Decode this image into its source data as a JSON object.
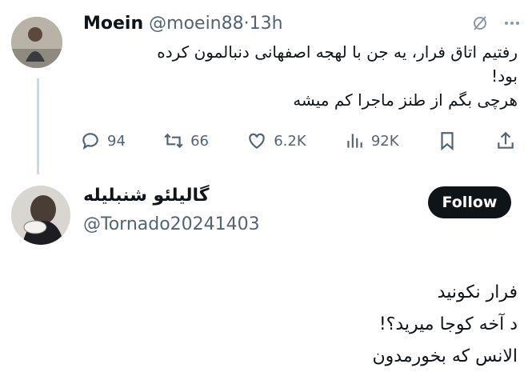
{
  "tweet": {
    "author_name": "Moein",
    "author_handle": "@moein88",
    "separator": "·",
    "time": "13h",
    "lines": [
      "رفتیم اتاق فرار، یه جن با لهجه اصفهانی دنبالمون کرده",
      "بود!",
      "هرچی بگم از طنز ماجرا کم میشه"
    ],
    "actions": {
      "replies": "94",
      "retweets": "66",
      "likes": "6.2K",
      "views": "92K"
    }
  },
  "reply": {
    "author_name": "گالیلئو شنبلیله",
    "author_handle": "@Tornado20241403",
    "follow_label": "Follow",
    "lines": [
      "فرار نکونید",
      "د آخه کوجا میرید؟!",
      "الانس که بخورمدون"
    ]
  },
  "icons": {
    "top_right": [
      "grok-icon",
      "more-icon"
    ],
    "actions": [
      "reply-icon",
      "retweet-icon",
      "like-icon",
      "views-icon",
      "bookmark-icon",
      "share-icon"
    ]
  }
}
